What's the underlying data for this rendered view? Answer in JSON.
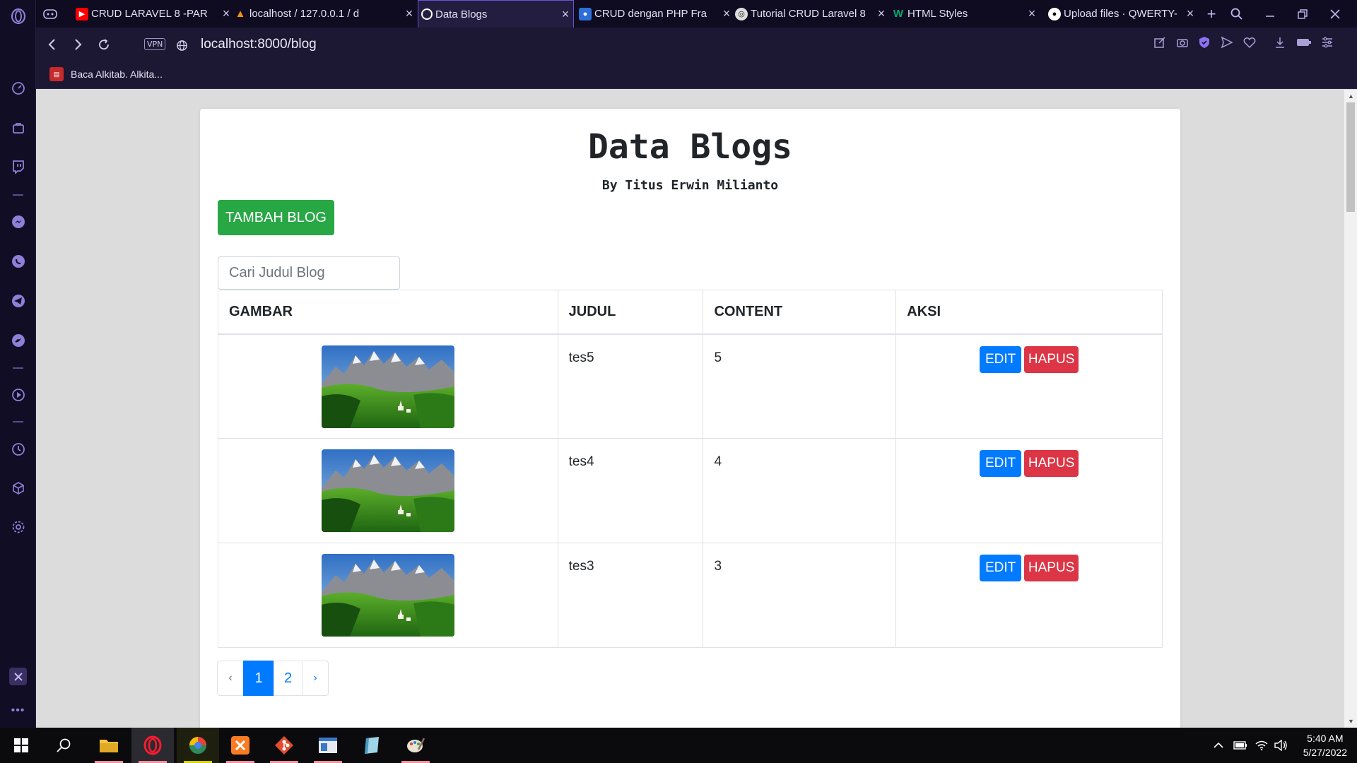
{
  "browser": {
    "tabs": [
      {
        "title": "CRUD LARAVEL 8 -PAR",
        "favicon": "youtube-icon",
        "color": "#ff0000"
      },
      {
        "title": "localhost / 127.0.0.1 / d",
        "favicon": "phpmyadmin-icon",
        "color": "#f29111"
      },
      {
        "title": "Data Blogs",
        "favicon": "globe-icon",
        "color": "#ffffff",
        "active": true
      },
      {
        "title": "CRUD dengan PHP Fra",
        "favicon": "profile-icon",
        "color": "#2d6fd8"
      },
      {
        "title": "Tutorial CRUD Laravel 8",
        "favicon": "site-icon",
        "color": "#dddddd"
      },
      {
        "title": "HTML Styles",
        "favicon": "w3schools-icon",
        "color": "#04aa6d"
      },
      {
        "title": "Upload files · QWERTY-",
        "favicon": "github-icon",
        "color": "#ffffff"
      }
    ],
    "address": "localhost:8000/blog",
    "vpn_label": "VPN",
    "bookmarks": [
      {
        "label": "Baca Alkitab. Alkita..."
      }
    ]
  },
  "page": {
    "title": "Data Blogs",
    "subtitle": "By Titus Erwin Milianto",
    "add_button": "TAMBAH BLOG",
    "search_placeholder": "Cari Judul Blog",
    "columns": [
      "GAMBAR",
      "JUDUL",
      "CONTENT",
      "AKSI"
    ],
    "rows": [
      {
        "judul": "tes5",
        "content": "5"
      },
      {
        "judul": "tes4",
        "content": "4"
      },
      {
        "judul": "tes3",
        "content": "3"
      }
    ],
    "edit_label": "EDIT",
    "delete_label": "HAPUS",
    "pagination": {
      "prev": "‹",
      "pages": [
        "1",
        "2"
      ],
      "next": "›",
      "current": "1"
    }
  },
  "taskbar": {
    "time": "5:40 AM",
    "date": "5/27/2022"
  },
  "colors": {
    "success": "#28a745",
    "primary": "#007bff",
    "danger": "#dc3545",
    "browser_dark": "#110d24"
  }
}
